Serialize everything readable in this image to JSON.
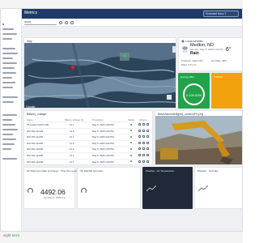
{
  "app": {
    "title": "Metrics"
  },
  "header": {
    "site_selector": "Simulated Nano T"
  },
  "filter": {
    "value": "quarr"
  },
  "map": {
    "title": "Map",
    "attribution": "Google"
  },
  "weather": {
    "title": "Local weather",
    "city": "Medker, ND",
    "date": "Monday, May 5, 2025 4:00 PM",
    "condition": "Rain",
    "temp": "6°",
    "pressure": "Pressure: 1014 hPa",
    "humidity": "Humidity: 95%",
    "wind": "Wind: 3.5 m/s"
  },
  "tiles": {
    "green": {
      "title": "Energy effort",
      "value": "0.100.00%"
    },
    "orange": {
      "title": "Frobilinir"
    }
  },
  "table": {
    "title": "Battery_voltage",
    "columns": [
      "Name ↑↑",
      "Battery Voltage (V)",
      "Timestamp",
      "Status",
      "Actions"
    ],
    "rows": [
      {
        "name": "Pit Loader F000 F190",
        "voltage": "13.7",
        "timestamp": "May 5, 2025 4:00 PM"
      },
      {
        "name": "2K6 F01 HH193",
        "voltage": "13.5",
        "timestamp": "May 5, 2025 4:00 PM"
      },
      {
        "name": "2K6 F01 HH195",
        "voltage": "13.1",
        "timestamp": "May 5, 2025 4:00 PM"
      },
      {
        "name": "2K6 F01 HH196",
        "voltage": "12.9",
        "timestamp": "May 5, 2025 4:00 PM"
      },
      {
        "name": "2K6 F01 HH200",
        "voltage": "12.6",
        "timestamp": "May 5, 2025 4:00 PM"
      },
      {
        "name": "2K6 F01 HH205",
        "voltage": "12.4",
        "timestamp": "May 5, 2025 4:00 PM"
      },
      {
        "name": "2K6 F01 HH208",
        "voltage": "12.1",
        "timestamp": "May 5, 2025 4:00 PM"
      }
    ]
  },
  "camera": {
    "title": "BetaVideoIntelligent_cameraFH.png"
  },
  "bottom": {
    "card1": {
      "title": "SK Maximum Rate of Charge - Time Per Level",
      "value": "4492.06",
      "sub": "Simulated - PPRPT E"
    },
    "card2": {
      "title": "SK Rainfall Summary"
    },
    "card3": {
      "title": "Weather - Air Temperature"
    },
    "card4": {
      "title": "Weather - Humidity"
    }
  },
  "footer": {
    "brand": "sight",
    "brand_tm": "terra"
  },
  "colors": {
    "header": "#1f3a66",
    "green": "#22a34a",
    "orange": "#f2a20c",
    "marker": "#e11d2a"
  }
}
